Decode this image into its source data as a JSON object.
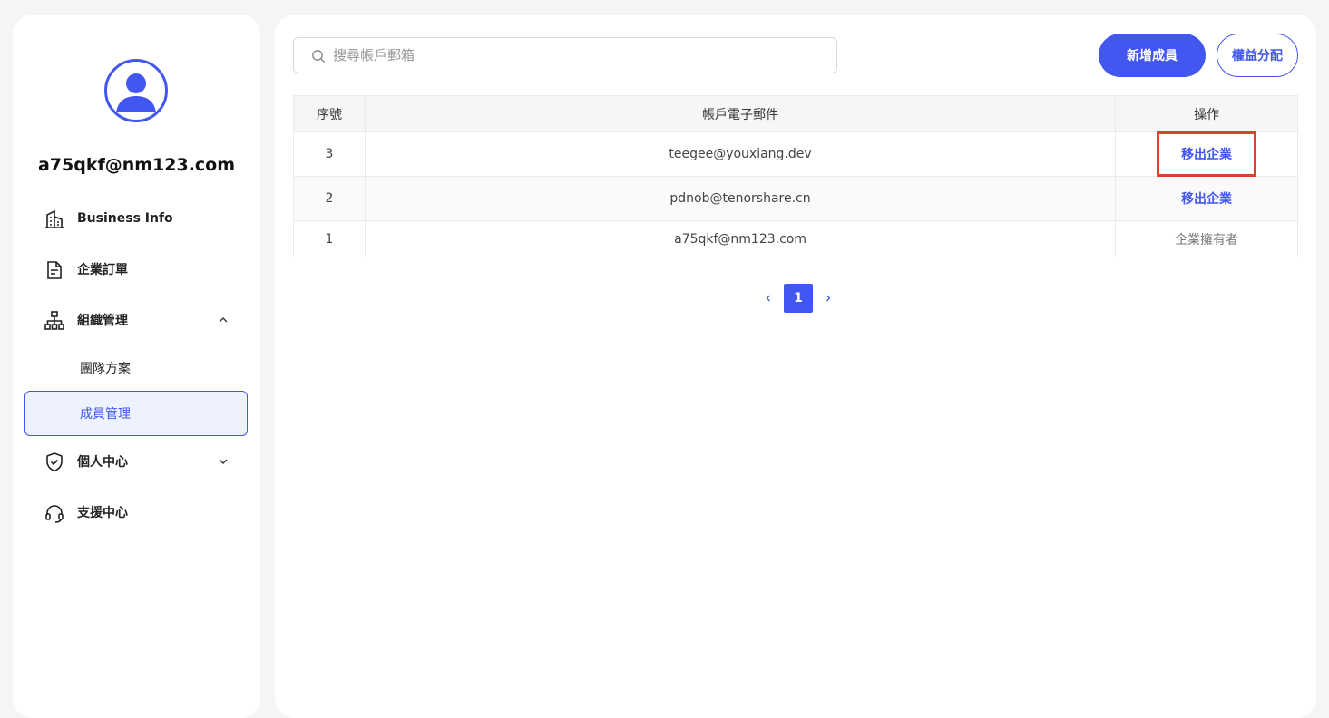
{
  "sidebar": {
    "account_email": "a75qkf@nm123.com",
    "nav": [
      {
        "label": "Business Info",
        "icon": "building-icon"
      },
      {
        "label": "企業訂單",
        "icon": "document-icon"
      },
      {
        "label": "組織管理",
        "icon": "org-chart-icon",
        "expanded": true
      },
      {
        "label": "個人中心",
        "icon": "shield-icon",
        "expanded": false
      },
      {
        "label": "支援中心",
        "icon": "headset-icon"
      }
    ],
    "sub_items": [
      {
        "label": "團隊方案",
        "active": false
      },
      {
        "label": "成員管理",
        "active": true
      }
    ]
  },
  "toolbar": {
    "search_placeholder": "搜尋帳戶郵箱",
    "add_member_label": "新增成員",
    "assign_rights_label": "權益分配"
  },
  "table": {
    "headers": [
      "序號",
      "帳戶電子郵件",
      "操作"
    ],
    "rows": [
      {
        "index": "3",
        "email": "teegee@youxiang.dev",
        "action": "移出企業",
        "highlighted": true
      },
      {
        "index": "2",
        "email": "pdnob@tenorshare.cn",
        "action": "移出企業"
      },
      {
        "index": "1",
        "email": "a75qkf@nm123.com",
        "action": "企業擁有者"
      }
    ]
  },
  "pagination": {
    "current_page": "1"
  },
  "colors": {
    "accent": "#4257f0",
    "highlight_box": "#d9432c"
  }
}
